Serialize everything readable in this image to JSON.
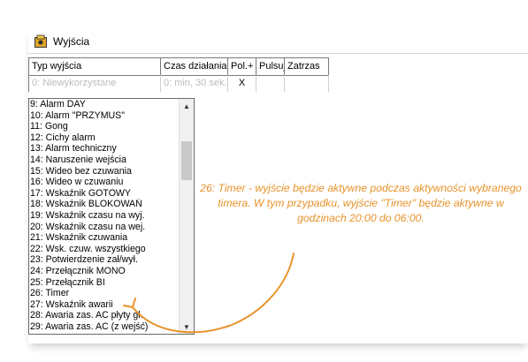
{
  "window": {
    "title": "Wyjścia"
  },
  "grid": {
    "columns": [
      "Typ wyjścia",
      "Czas działania",
      "Pol.+",
      "Pulsuj",
      "Zatrzas"
    ],
    "first_row": {
      "type": "0: Niewykorzystane",
      "time": "0: min, 30 sek.",
      "pol": "X"
    }
  },
  "dropdown": {
    "items": [
      "9: Alarm DAY",
      "10: Alarm \"PRZYMUS\"",
      "11: Gong",
      "12: Cichy alarm",
      "13: Alarm techniczny",
      "14: Naruszenie wejścia",
      "15: Wideo bez czuwania",
      "16: Wideo w czuwaniu",
      "17: Wskaźnik GOTOWY",
      "18: Wskaźnik BLOKOWAŃ",
      "19: Wskaźnik czasu na wyj.",
      "20: Wskaźnik czasu na wej.",
      "21: Wskaźnik czuwania",
      "22: Wsk. czuw. wszystkiego",
      "23: Potwierdzenie zał/wył.",
      "24: Przełącznik MONO",
      "25: Przełącznik BI",
      "26: Timer",
      "27: Wskaźnik awarii",
      "28: Awaria zas. AC płyty gł.",
      "29: Awaria zas. AC (z wejść)"
    ],
    "scroll_position": 0.17,
    "scroll_visible_fraction": 0.19
  },
  "annotation": {
    "text": "26: Timer - wyjście będzie aktywne podczas aktywności wybranego timera. W tym przypadku, wyjście \"Timer\" będzie aktywne w godzinach 20:00 do 06:00."
  },
  "colors": {
    "accent": "#e8922a",
    "grid_border": "#7a7a7a",
    "disabled_text": "#bdbdbd"
  },
  "icons": {
    "title": "outputs-icon",
    "scroll_up": "arrow-up-icon",
    "scroll_down": "arrow-down-icon"
  }
}
